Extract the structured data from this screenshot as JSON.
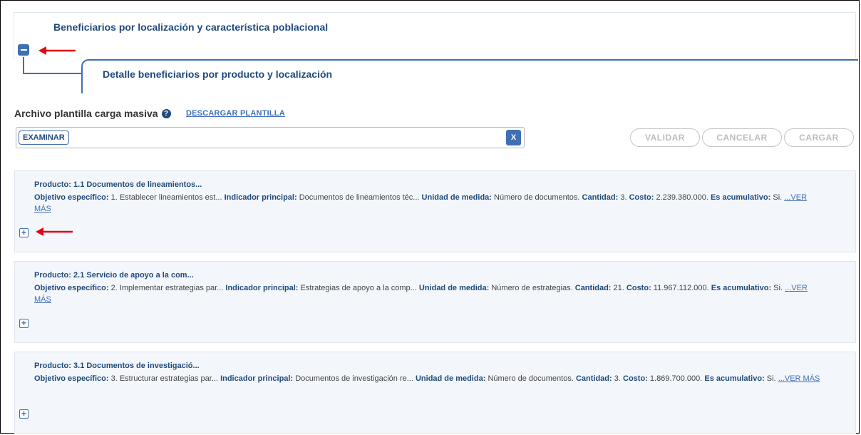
{
  "sections": {
    "main_title": "Beneficiarios por localización y característica poblacional",
    "sub_title": "Detalle beneficiarios por producto y localización"
  },
  "upload": {
    "label": "Archivo plantilla carga masiva",
    "download_link": "DESCARGAR PLANTILLA",
    "browse_label": "EXAMINAR",
    "clear_label": "X",
    "validate_label": "VALIDAR",
    "cancel_label": "CANCELAR",
    "load_label": "CARGAR"
  },
  "labels": {
    "producto": "Producto:",
    "objetivo": "Objetivo específico:",
    "indicador": "Indicador principal:",
    "unidad": "Unidad de medida:",
    "cantidad": "Cantidad:",
    "costo": "Costo:",
    "acumulativo": "Es acumulativo:",
    "ver_mas": "...VER MÁS"
  },
  "products": [
    {
      "title": "1.1 Documentos de lineamientos...",
      "objetivo": "1. Establecer lineamientos est...",
      "indicador": "Documentos de lineamientos téc...",
      "unidad": "Número de documentos.",
      "cantidad": "3.",
      "costo": "2.239.380.000.",
      "acumulativo": "Si."
    },
    {
      "title": "2.1 Servicio de apoyo a la com...",
      "objetivo": "2. Implementar estrategias par...",
      "indicador": "Estrategias de apoyo a la comp...",
      "unidad": "Número de estrategias.",
      "cantidad": "21.",
      "costo": "11.967.112.000.",
      "acumulativo": "Si."
    },
    {
      "title": "3.1 Documentos de investigació...",
      "objetivo": "3. Estructurar estrategias par...",
      "indicador": "Documentos de investigación re...",
      "unidad": "Número de documentos.",
      "cantidad": "3.",
      "costo": "1.869.700.000.",
      "acumulativo": "Si."
    }
  ],
  "colors": {
    "primary": "#3f6fb5",
    "title": "#1f4a7c",
    "annotation_arrow": "#e30613"
  }
}
